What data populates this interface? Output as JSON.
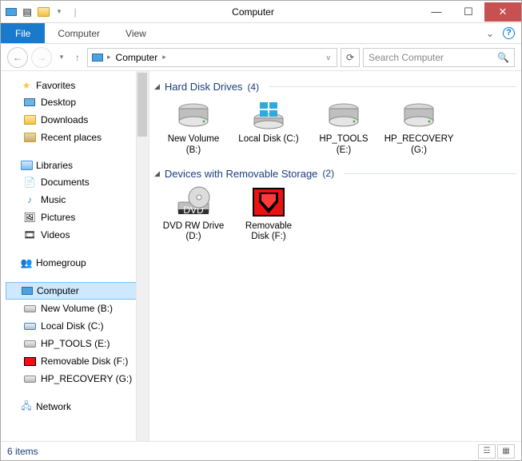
{
  "window": {
    "title": "Computer"
  },
  "ribbon": {
    "file": "File",
    "tabs": [
      "Computer",
      "View"
    ]
  },
  "address": {
    "location": "Computer"
  },
  "search": {
    "placeholder": "Search Computer"
  },
  "nav": {
    "favorites": {
      "label": "Favorites",
      "items": [
        "Desktop",
        "Downloads",
        "Recent places"
      ]
    },
    "libraries": {
      "label": "Libraries",
      "items": [
        "Documents",
        "Music",
        "Pictures",
        "Videos"
      ]
    },
    "homegroup": {
      "label": "Homegroup"
    },
    "computer": {
      "label": "Computer",
      "items": [
        "New Volume (B:)",
        "Local Disk (C:)",
        "HP_TOOLS (E:)",
        "Removable Disk (F:)",
        "HP_RECOVERY (G:)"
      ]
    },
    "network": {
      "label": "Network"
    }
  },
  "groups": [
    {
      "name": "Hard Disk Drives",
      "count": "(4)",
      "items": [
        {
          "label": "New Volume (B:)",
          "kind": "hdd"
        },
        {
          "label": "Local Disk (C:)",
          "kind": "hdd-win"
        },
        {
          "label": "HP_TOOLS (E:)",
          "kind": "hdd"
        },
        {
          "label": "HP_RECOVERY (G:)",
          "kind": "hdd"
        }
      ]
    },
    {
      "name": "Devices with Removable Storage",
      "count": "(2)",
      "items": [
        {
          "label": "DVD RW Drive (D:)",
          "kind": "dvd"
        },
        {
          "label": "Removable Disk (F:)",
          "kind": "removable"
        }
      ]
    }
  ],
  "status": {
    "text": "6 items"
  }
}
